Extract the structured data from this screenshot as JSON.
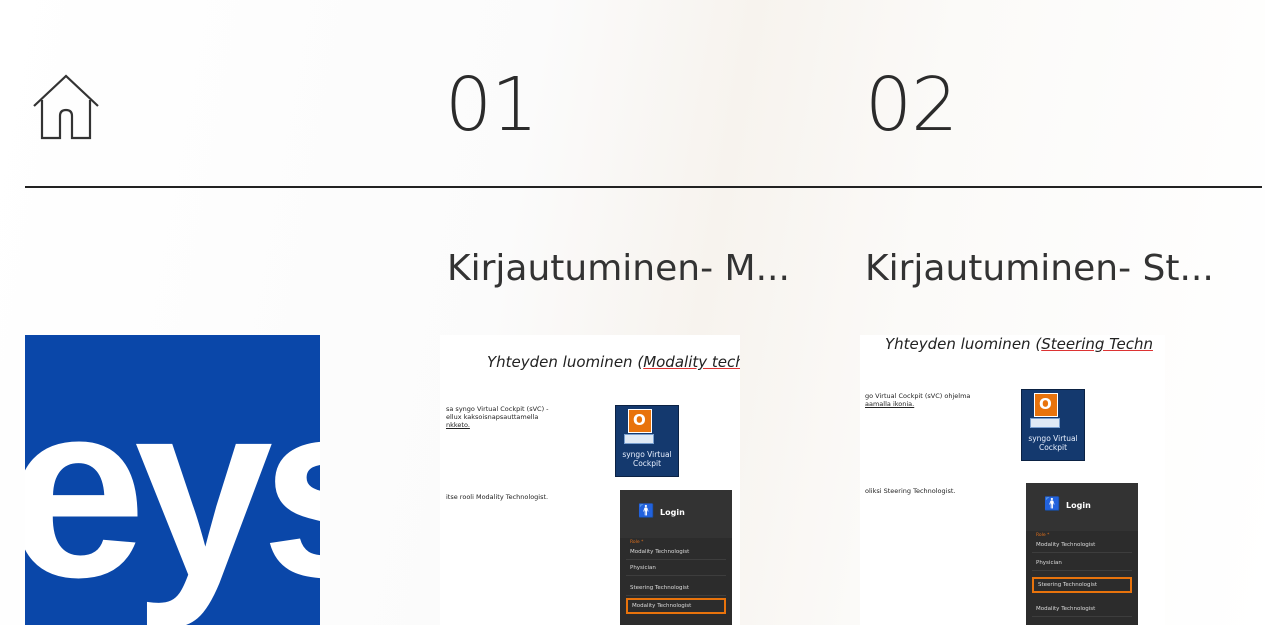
{
  "header": {
    "home_icon": "home-icon",
    "section_numbers": [
      "01",
      "02"
    ]
  },
  "tiles": [
    {
      "title": "Kirjautuminen- M...",
      "doc_title_prefix": "Yhteyden luominen (",
      "doc_title_underlined": "Modality techn",
      "para1_lines": [
        "sa syngo Virtual Cockpit (sVC) -",
        "ellux             kaksoisnapsauttamella",
        "nkketo."
      ],
      "para2": "itse rooli Modality Technologist.",
      "app_tile_label": [
        "syngo Virtual",
        "Cockpit"
      ],
      "login_title": "Login",
      "role_label": "Role *",
      "roles": [
        "Modality Technologist",
        "Physician",
        "Steering Technologist",
        "Modality Technologist"
      ],
      "selected_role_index": 3
    },
    {
      "title": "Kirjautuminen- St...",
      "doc_title_prefix": "Yhteyden luominen (",
      "doc_title_underlined": "Steering Techn",
      "para1_lines": [
        "go Virtual Cockpit (sVC) ohjelma",
        "aamalla ikonia."
      ],
      "para2": "oliksi Steering Technologist.",
      "app_tile_label": [
        "syngo Virtual",
        "Cockpit"
      ],
      "login_title": "Login",
      "role_label": "Role *",
      "roles": [
        "Modality Technologist",
        "Physician",
        "Steering Technologist",
        "Modality Technologist"
      ],
      "selected_role_index": 2
    }
  ],
  "logo": {
    "text": "eys",
    "background": "#0a47a9"
  },
  "colors": {
    "accent_orange": "#e8730c",
    "logo_blue": "#0a47a9",
    "divider": "#222222"
  }
}
